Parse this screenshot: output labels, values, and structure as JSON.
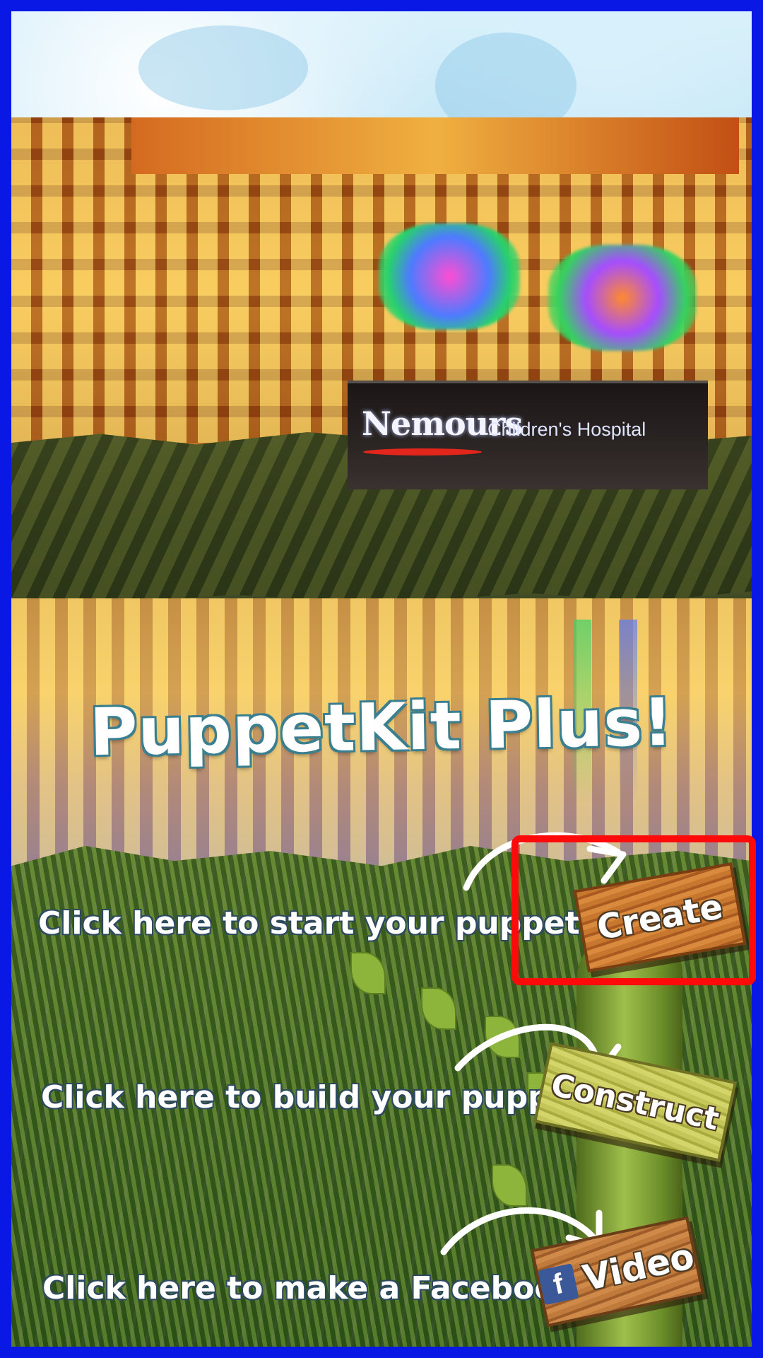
{
  "sign": {
    "brand": "Nemours",
    "subtitle": "Children's Hospital"
  },
  "title": "PuppetKit Plus!",
  "instructions": [
    {
      "text": "Click here to start your puppet",
      "button": "Create"
    },
    {
      "text": "Click here to build your puppet",
      "button": "Construct"
    },
    {
      "text": "Click here to make a Facebook video",
      "button": "Video"
    }
  ],
  "icons": {
    "facebook": "f"
  },
  "colors": {
    "border": "#0a18e6",
    "highlight": "#ff0a0a",
    "facebook": "#3b5998"
  }
}
